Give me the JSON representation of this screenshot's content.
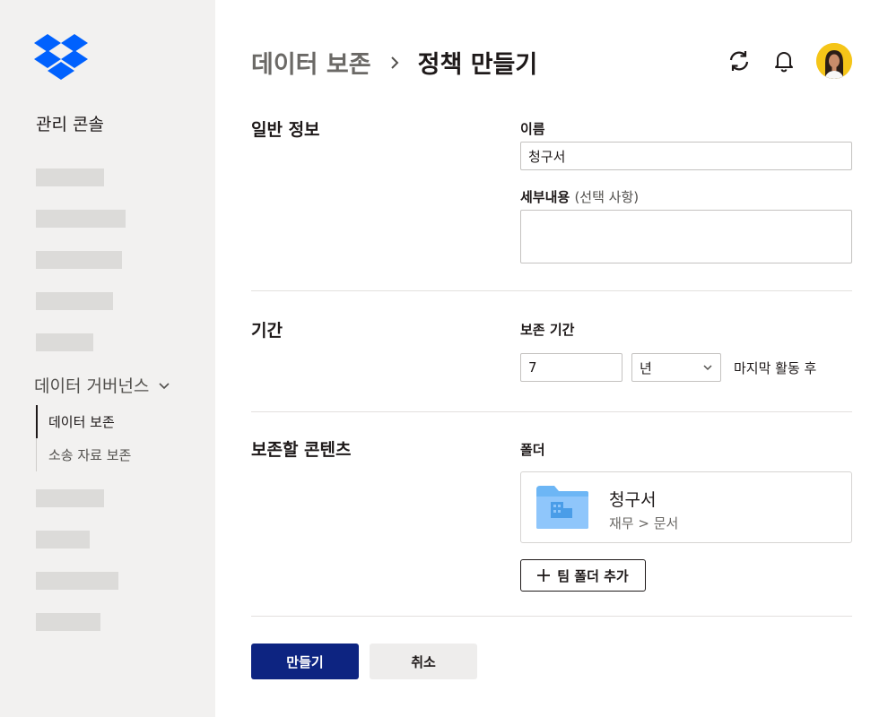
{
  "sidebar": {
    "console_title": "관리 콘솔",
    "group_label": "데이터 거버넌스",
    "sub_items": [
      {
        "label": "데이터 보존",
        "active": true
      },
      {
        "label": "소송 자료 보존",
        "active": false
      }
    ]
  },
  "header": {
    "breadcrumb_parent": "데이터 보존",
    "breadcrumb_current": "정책 만들기"
  },
  "general": {
    "title": "일반 정보",
    "name_label": "이름",
    "name_value": "청구서",
    "details_label": "세부내용",
    "details_optional": "(선택 사항)",
    "details_value": ""
  },
  "period": {
    "title": "기간",
    "retention_label": "보존 기간",
    "amount": "7",
    "unit": "년",
    "after_text": "마지막 활동 후"
  },
  "content": {
    "title": "보존할 콘텐츠",
    "folder_label": "폴더",
    "folder_name": "청구서",
    "folder_path": "재무 > 문서",
    "add_button": "팀 폴더 추가"
  },
  "actions": {
    "create": "만들기",
    "cancel": "취소"
  },
  "colors": {
    "primary": "#0d2481",
    "brand": "#0061fe",
    "folder": "#8fc6fb"
  }
}
